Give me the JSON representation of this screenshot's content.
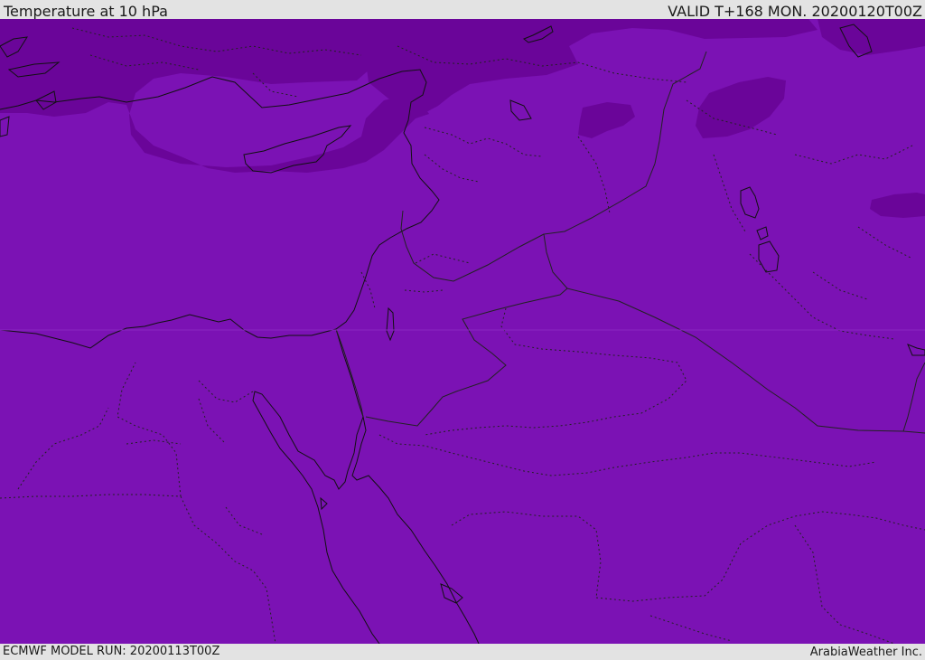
{
  "header": {
    "title": "Temperature at 10 hPa",
    "valid": "VALID T+168 MON. 20200120T00Z"
  },
  "footer": {
    "model_run": "ECMWF MODEL RUN: 20200113T00Z",
    "credit": "ArabiaWeather Inc."
  },
  "map": {
    "field": "temperature",
    "level": "10 hPa",
    "colors": {
      "base_fill": "#7b12b4",
      "cold_fill": "#6a0599",
      "coast": "#111111",
      "border": "#222222"
    }
  }
}
